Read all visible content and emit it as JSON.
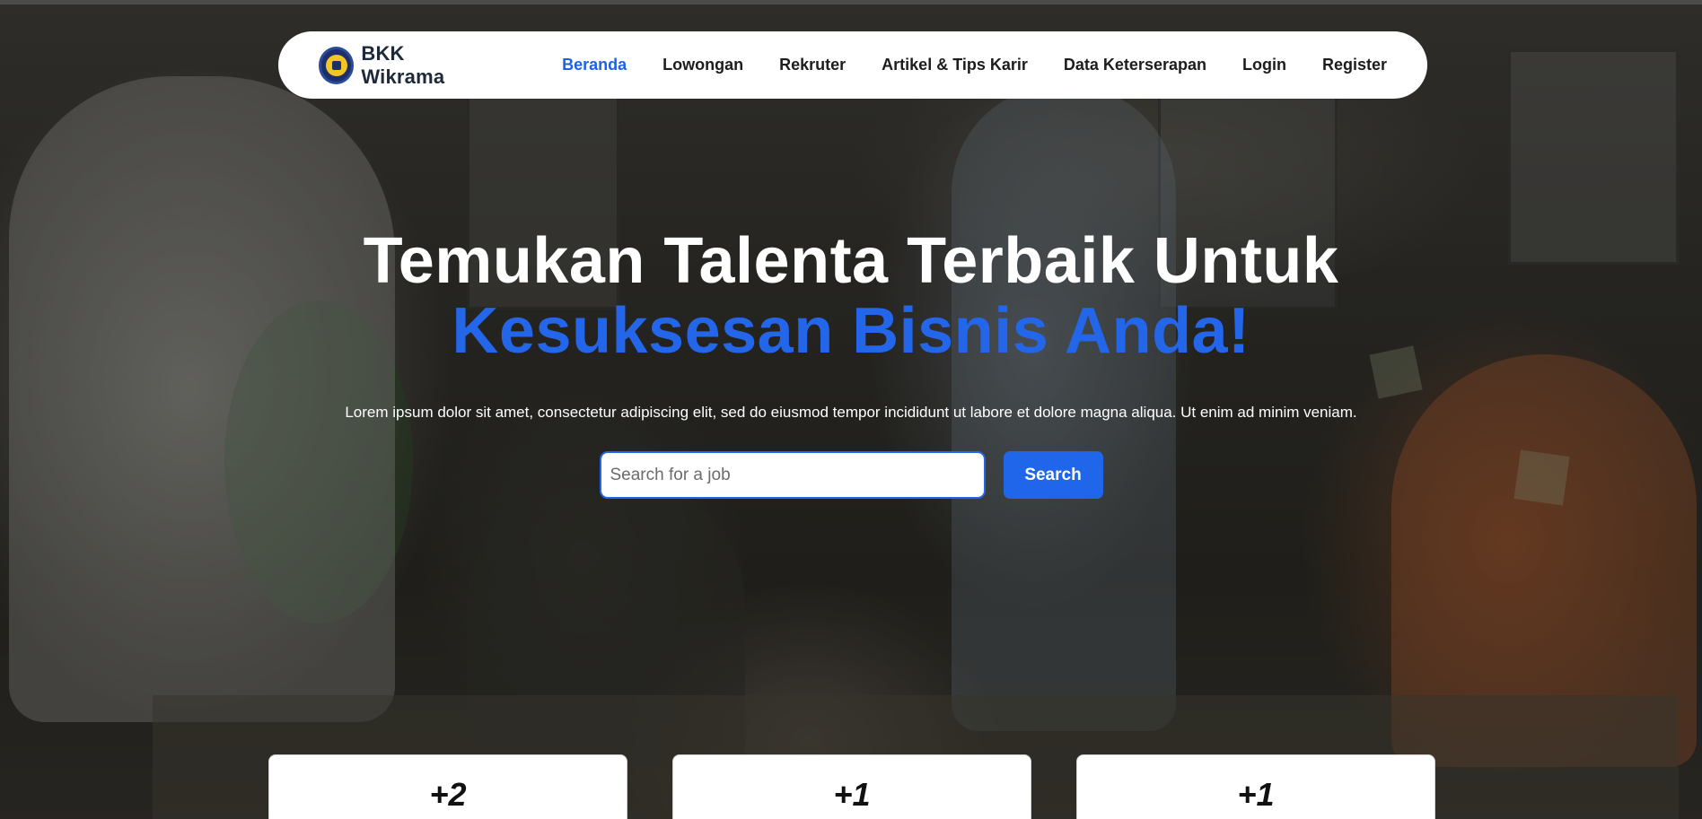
{
  "brand": {
    "name": "BKK Wikrama",
    "logo_icon": "school-emblem-icon",
    "colors": {
      "primary": "#1d62e6",
      "logo_navy": "#1c2f6b",
      "logo_gold": "#f3c623"
    }
  },
  "nav": {
    "items": [
      {
        "label": "Beranda",
        "active": true
      },
      {
        "label": "Lowongan",
        "active": false
      },
      {
        "label": "Rekruter",
        "active": false
      },
      {
        "label": "Artikel & Tips Karir",
        "active": false
      },
      {
        "label": "Data Keterserapan",
        "active": false
      },
      {
        "label": "Login",
        "active": false
      },
      {
        "label": "Register",
        "active": false
      }
    ]
  },
  "hero": {
    "title_line1": "Temukan Talenta Terbaik Untuk",
    "title_line2": "Kesuksesan Bisnis Anda!",
    "description": "Lorem ipsum dolor sit amet, consectetur adipiscing elit, sed do eiusmod tempor incididunt ut labore et dolore magna aliqua. Ut enim ad minim veniam.",
    "search": {
      "placeholder": "Search for a job",
      "value": "",
      "button_label": "Search"
    }
  },
  "stats": [
    {
      "value": "+2"
    },
    {
      "value": "+1"
    },
    {
      "value": "+1"
    }
  ]
}
